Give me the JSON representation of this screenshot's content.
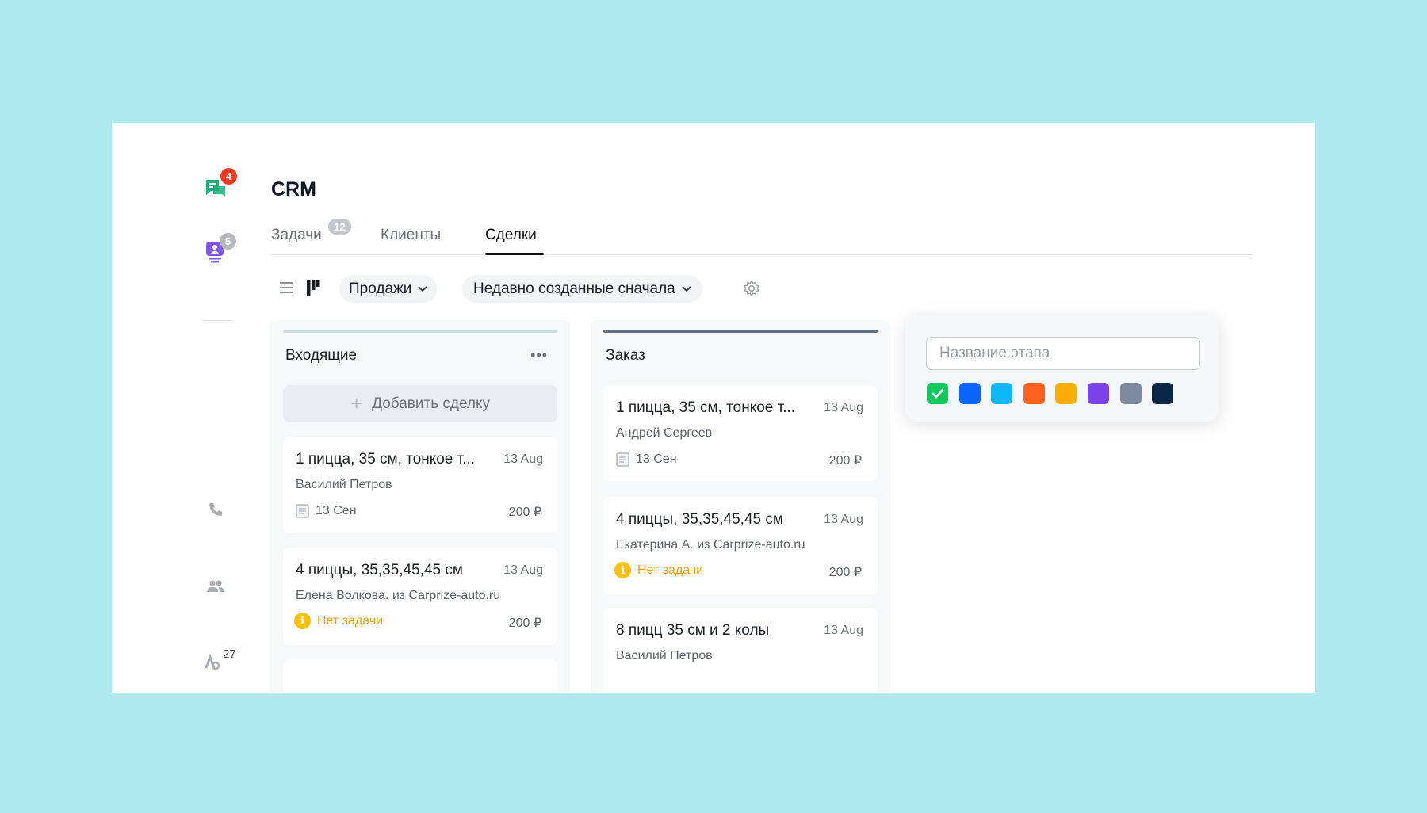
{
  "sidebar": {
    "chat_badge": "4",
    "ideas_badge": "5",
    "contacts_count": "27"
  },
  "header": {
    "title": "CRM"
  },
  "tabs": [
    {
      "label": "Задачи",
      "badge": "12"
    },
    {
      "label": "Клиенты"
    },
    {
      "label": "Сделки",
      "active": true
    }
  ],
  "toolbar": {
    "pipeline": "Продажи",
    "sort": "Недавно созданные сначала"
  },
  "columns": [
    {
      "name": "Входящие",
      "color": "#c9dde3",
      "add_label": "Добавить сделку",
      "cards": [
        {
          "title": "1 пицца, 35 см, тонкое т...",
          "date": "13 Aug",
          "client": "Василий Петров",
          "task": "13 Сен",
          "price": "200 ₽"
        },
        {
          "title": "4 пиццы, 35,35,45,45 см",
          "date": "13 Aug",
          "client": "Елена Волкова.  из Carprize-auto.ru",
          "task": "Нет задачи",
          "price": "200 ₽"
        }
      ]
    },
    {
      "name": "Заказ",
      "color": "#5f6f80",
      "cards": [
        {
          "title": "1 пицца, 35 см, тонкое т...",
          "date": "13 Aug",
          "client": "Андрей Сергеев",
          "task": "13 Сен",
          "price": "200 ₽"
        },
        {
          "title": "4 пиццы, 35,35,45,45 см",
          "date": "13 Aug",
          "client": "Екатерина А. из Carprize-auto.ru",
          "task": "Нет задачи",
          "price": "200 ₽"
        },
        {
          "title": "8 пицц 35 см и 2 колы",
          "date": "13 Aug",
          "client": "Василий Петров"
        }
      ]
    }
  ],
  "stage_popup": {
    "placeholder": "Название этапа",
    "colors": [
      "#12c75c",
      "#0866ff",
      "#0db8ff",
      "#ff621f",
      "#ffad03",
      "#7b42ea",
      "#7b8a9e",
      "#0b2545"
    ],
    "selected": 0
  }
}
